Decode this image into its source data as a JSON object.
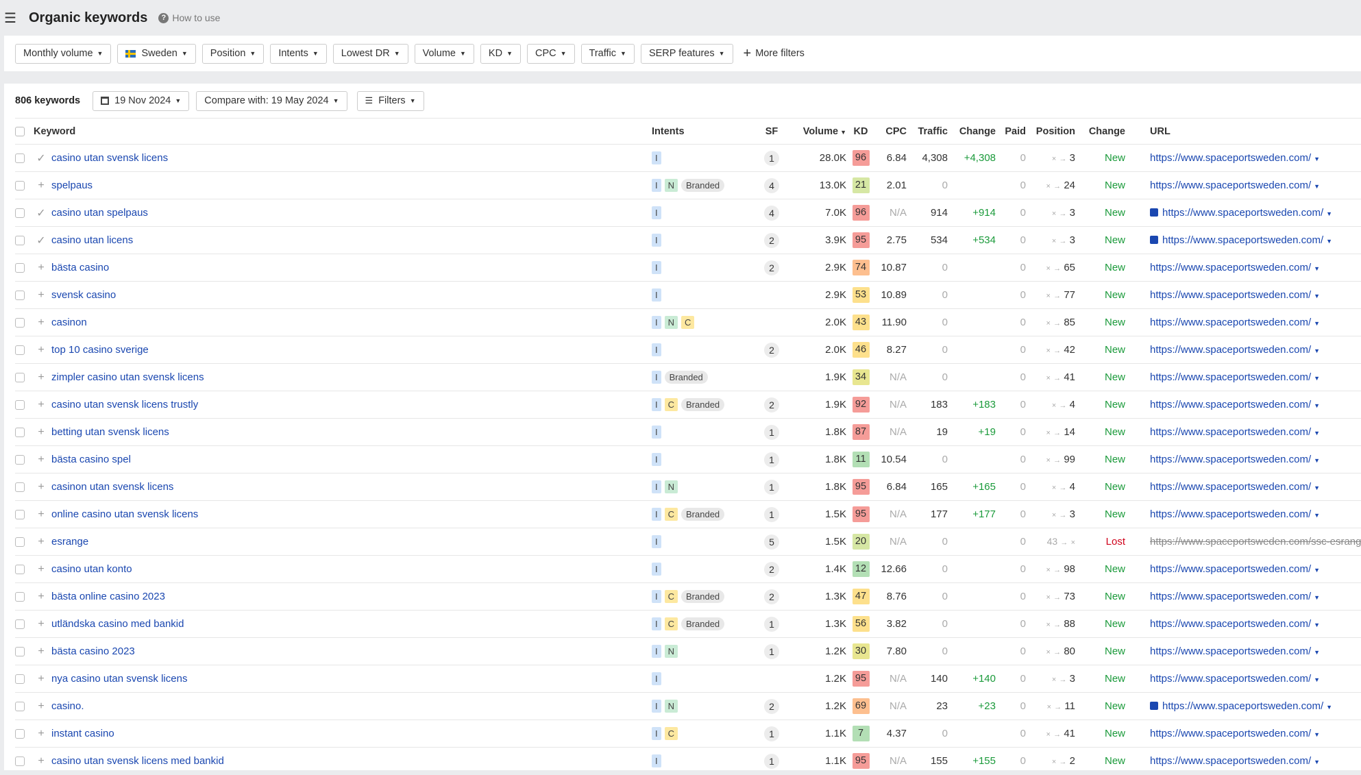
{
  "header": {
    "title": "Organic keywords",
    "help": "How to use"
  },
  "filters": [
    "Monthly volume",
    "Sweden",
    "Position",
    "Intents",
    "Lowest DR",
    "Volume",
    "KD",
    "CPC",
    "Traffic",
    "SERP features"
  ],
  "more_filters": "More filters",
  "toolbar": {
    "count": "806 keywords",
    "date": "19 Nov 2024",
    "compare": "Compare with: 19 May 2024",
    "filters": "Filters"
  },
  "columns": {
    "keyword": "Keyword",
    "intents": "Intents",
    "sf": "SF",
    "volume": "Volume",
    "kd": "KD",
    "cpc": "CPC",
    "traffic": "Traffic",
    "change": "Change",
    "paid": "Paid",
    "position": "Position",
    "change2": "Change",
    "url": "URL"
  },
  "kd_colors": {
    "red": "#f59c98",
    "orange": "#fdbf8f",
    "yellow": "#fde08c",
    "yellowgreen": "#e8e690",
    "lightgreen": "#d6e7a4",
    "green": "#b3dfb5"
  },
  "rows": [
    {
      "kw": "casino utan svensk licens",
      "mark": "check",
      "intents": [
        "I"
      ],
      "sf": "1",
      "vol": "28.0K",
      "kd": 96,
      "cpc": "6.84",
      "traffic": "4,308",
      "change": "+4,308",
      "paid": "0",
      "from": "×",
      "to": "3",
      "status": "New",
      "url": "https://www.spaceportsweden.com/",
      "img": false
    },
    {
      "kw": "spelpaus",
      "mark": "plus",
      "intents": [
        "I",
        "N",
        "Branded"
      ],
      "sf": "4",
      "vol": "13.0K",
      "kd": 21,
      "cpc": "2.01",
      "traffic": "0",
      "change": "",
      "paid": "0",
      "from": "×",
      "to": "24",
      "status": "New",
      "url": "https://www.spaceportsweden.com/",
      "img": false
    },
    {
      "kw": "casino utan spelpaus",
      "mark": "check",
      "intents": [
        "I"
      ],
      "sf": "4",
      "vol": "7.0K",
      "kd": 96,
      "cpc": "N/A",
      "traffic": "914",
      "change": "+914",
      "paid": "0",
      "from": "×",
      "to": "3",
      "status": "New",
      "url": "https://www.spaceportsweden.com/",
      "img": true
    },
    {
      "kw": "casino utan licens",
      "mark": "check",
      "intents": [
        "I"
      ],
      "sf": "2",
      "vol": "3.9K",
      "kd": 95,
      "cpc": "2.75",
      "traffic": "534",
      "change": "+534",
      "paid": "0",
      "from": "×",
      "to": "3",
      "status": "New",
      "url": "https://www.spaceportsweden.com/",
      "img": true
    },
    {
      "kw": "bästa casino",
      "mark": "plus",
      "intents": [
        "I"
      ],
      "sf": "2",
      "vol": "2.9K",
      "kd": 74,
      "cpc": "10.87",
      "traffic": "0",
      "change": "",
      "paid": "0",
      "from": "×",
      "to": "65",
      "status": "New",
      "url": "https://www.spaceportsweden.com/",
      "img": false
    },
    {
      "kw": "svensk casino",
      "mark": "plus",
      "intents": [
        "I"
      ],
      "sf": "",
      "vol": "2.9K",
      "kd": 53,
      "cpc": "10.89",
      "traffic": "0",
      "change": "",
      "paid": "0",
      "from": "×",
      "to": "77",
      "status": "New",
      "url": "https://www.spaceportsweden.com/",
      "img": false
    },
    {
      "kw": "casinon",
      "mark": "plus",
      "intents": [
        "I",
        "N",
        "C"
      ],
      "sf": "",
      "vol": "2.0K",
      "kd": 43,
      "cpc": "11.90",
      "traffic": "0",
      "change": "",
      "paid": "0",
      "from": "×",
      "to": "85",
      "status": "New",
      "url": "https://www.spaceportsweden.com/",
      "img": false
    },
    {
      "kw": "top 10 casino sverige",
      "mark": "plus",
      "intents": [
        "I"
      ],
      "sf": "2",
      "vol": "2.0K",
      "kd": 46,
      "cpc": "8.27",
      "traffic": "0",
      "change": "",
      "paid": "0",
      "from": "×",
      "to": "42",
      "status": "New",
      "url": "https://www.spaceportsweden.com/",
      "img": false
    },
    {
      "kw": "zimpler casino utan svensk licens",
      "mark": "plus",
      "intents": [
        "I",
        "Branded"
      ],
      "sf": "",
      "vol": "1.9K",
      "kd": 34,
      "cpc": "N/A",
      "traffic": "0",
      "change": "",
      "paid": "0",
      "from": "×",
      "to": "41",
      "status": "New",
      "url": "https://www.spaceportsweden.com/",
      "img": false
    },
    {
      "kw": "casino utan svensk licens trustly",
      "mark": "plus",
      "intents": [
        "I",
        "C",
        "Branded"
      ],
      "sf": "2",
      "vol": "1.9K",
      "kd": 92,
      "cpc": "N/A",
      "traffic": "183",
      "change": "+183",
      "paid": "0",
      "from": "×",
      "to": "4",
      "status": "New",
      "url": "https://www.spaceportsweden.com/",
      "img": false
    },
    {
      "kw": "betting utan svensk licens",
      "mark": "plus",
      "intents": [
        "I"
      ],
      "sf": "1",
      "vol": "1.8K",
      "kd": 87,
      "cpc": "N/A",
      "traffic": "19",
      "change": "+19",
      "paid": "0",
      "from": "×",
      "to": "14",
      "status": "New",
      "url": "https://www.spaceportsweden.com/",
      "img": false
    },
    {
      "kw": "bästa casino spel",
      "mark": "plus",
      "intents": [
        "I"
      ],
      "sf": "1",
      "vol": "1.8K",
      "kd": 11,
      "cpc": "10.54",
      "traffic": "0",
      "change": "",
      "paid": "0",
      "from": "×",
      "to": "99",
      "status": "New",
      "url": "https://www.spaceportsweden.com/",
      "img": false
    },
    {
      "kw": "casinon utan svensk licens",
      "mark": "plus",
      "intents": [
        "I",
        "N"
      ],
      "sf": "1",
      "vol": "1.8K",
      "kd": 95,
      "cpc": "6.84",
      "traffic": "165",
      "change": "+165",
      "paid": "0",
      "from": "×",
      "to": "4",
      "status": "New",
      "url": "https://www.spaceportsweden.com/",
      "img": false
    },
    {
      "kw": "online casino utan svensk licens",
      "mark": "plus",
      "intents": [
        "I",
        "C",
        "Branded"
      ],
      "sf": "1",
      "vol": "1.5K",
      "kd": 95,
      "cpc": "N/A",
      "traffic": "177",
      "change": "+177",
      "paid": "0",
      "from": "×",
      "to": "3",
      "status": "New",
      "url": "https://www.spaceportsweden.com/",
      "img": false
    },
    {
      "kw": "esrange",
      "mark": "plus",
      "intents": [
        "I"
      ],
      "sf": "5",
      "vol": "1.5K",
      "kd": 20,
      "cpc": "N/A",
      "traffic": "0",
      "change": "",
      "paid": "0",
      "from": "43",
      "to": "×",
      "status": "Lost",
      "url": "https://www.spaceportsweden.com/ssc-esrange-s",
      "img": false
    },
    {
      "kw": "casino utan konto",
      "mark": "plus",
      "intents": [
        "I"
      ],
      "sf": "2",
      "vol": "1.4K",
      "kd": 12,
      "cpc": "12.66",
      "traffic": "0",
      "change": "",
      "paid": "0",
      "from": "×",
      "to": "98",
      "status": "New",
      "url": "https://www.spaceportsweden.com/",
      "img": false
    },
    {
      "kw": "bästa online casino 2023",
      "mark": "plus",
      "intents": [
        "I",
        "C",
        "Branded"
      ],
      "sf": "2",
      "vol": "1.3K",
      "kd": 47,
      "cpc": "8.76",
      "traffic": "0",
      "change": "",
      "paid": "0",
      "from": "×",
      "to": "73",
      "status": "New",
      "url": "https://www.spaceportsweden.com/",
      "img": false
    },
    {
      "kw": "utländska casino med bankid",
      "mark": "plus",
      "intents": [
        "I",
        "C",
        "Branded"
      ],
      "sf": "1",
      "vol": "1.3K",
      "kd": 56,
      "cpc": "3.82",
      "traffic": "0",
      "change": "",
      "paid": "0",
      "from": "×",
      "to": "88",
      "status": "New",
      "url": "https://www.spaceportsweden.com/",
      "img": false
    },
    {
      "kw": "bästa casino 2023",
      "mark": "plus",
      "intents": [
        "I",
        "N"
      ],
      "sf": "1",
      "vol": "1.2K",
      "kd": 30,
      "cpc": "7.80",
      "traffic": "0",
      "change": "",
      "paid": "0",
      "from": "×",
      "to": "80",
      "status": "New",
      "url": "https://www.spaceportsweden.com/",
      "img": false
    },
    {
      "kw": "nya casino utan svensk licens",
      "mark": "plus",
      "intents": [
        "I"
      ],
      "sf": "",
      "vol": "1.2K",
      "kd": 95,
      "cpc": "N/A",
      "traffic": "140",
      "change": "+140",
      "paid": "0",
      "from": "×",
      "to": "3",
      "status": "New",
      "url": "https://www.spaceportsweden.com/",
      "img": false
    },
    {
      "kw": "casino.",
      "mark": "plus",
      "intents": [
        "I",
        "N"
      ],
      "sf": "2",
      "vol": "1.2K",
      "kd": 69,
      "cpc": "N/A",
      "traffic": "23",
      "change": "+23",
      "paid": "0",
      "from": "×",
      "to": "11",
      "status": "New",
      "url": "https://www.spaceportsweden.com/",
      "img": true
    },
    {
      "kw": "instant casino",
      "mark": "plus",
      "intents": [
        "I",
        "C"
      ],
      "sf": "1",
      "vol": "1.1K",
      "kd": 7,
      "cpc": "4.37",
      "traffic": "0",
      "change": "",
      "paid": "0",
      "from": "×",
      "to": "41",
      "status": "New",
      "url": "https://www.spaceportsweden.com/",
      "img": false
    },
    {
      "kw": "casino utan svensk licens med bankid",
      "mark": "plus",
      "intents": [
        "I"
      ],
      "sf": "1",
      "vol": "1.1K",
      "kd": 95,
      "cpc": "N/A",
      "traffic": "155",
      "change": "+155",
      "paid": "0",
      "from": "×",
      "to": "2",
      "status": "New",
      "url": "https://www.spaceportsweden.com/",
      "img": false
    }
  ]
}
